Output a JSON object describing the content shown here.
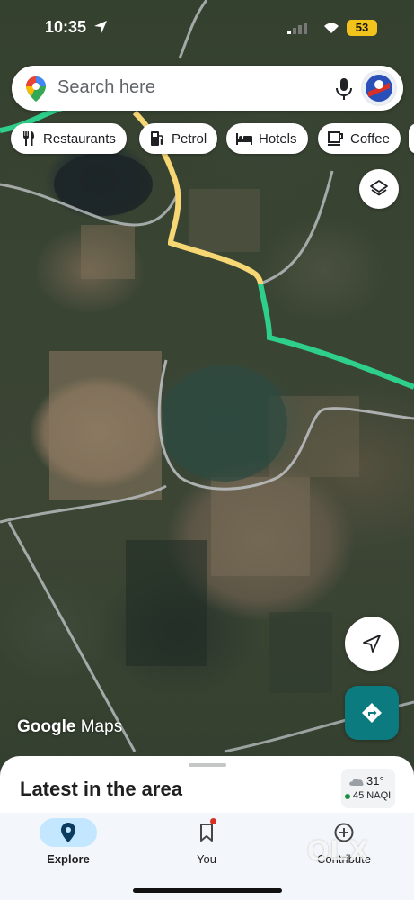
{
  "status_bar": {
    "time": "10:35",
    "battery": "53"
  },
  "search": {
    "placeholder": "Search here"
  },
  "chips": [
    {
      "label": "Restaurants",
      "icon": "fork-knife-icon"
    },
    {
      "label": "Petrol",
      "icon": "fuel-pump-icon"
    },
    {
      "label": "Hotels",
      "icon": "bed-icon"
    },
    {
      "label": "Coffee",
      "icon": "coffee-cup-icon"
    }
  ],
  "map": {
    "watermark_brand": "Google",
    "watermark_product": "Maps",
    "route_colors": {
      "highway": "#f7d774",
      "main": "#2ecf8a",
      "minor": "#bfc3c7"
    }
  },
  "sheet": {
    "title": "Latest in the area",
    "weather": {
      "temp": "31°",
      "aqi": "45 NAQI"
    }
  },
  "nav": {
    "items": [
      {
        "label": "Explore",
        "icon": "explore-pin-icon",
        "active": true
      },
      {
        "label": "You",
        "icon": "bookmark-icon",
        "active": false
      },
      {
        "label": "Contribute",
        "icon": "add-circle-icon",
        "active": false
      }
    ]
  },
  "overlay_watermark": "OLX",
  "colors": {
    "accent": "#0c7b80",
    "nav_active": "#c2e7ff",
    "aqi_good": "#1e8e3e"
  }
}
